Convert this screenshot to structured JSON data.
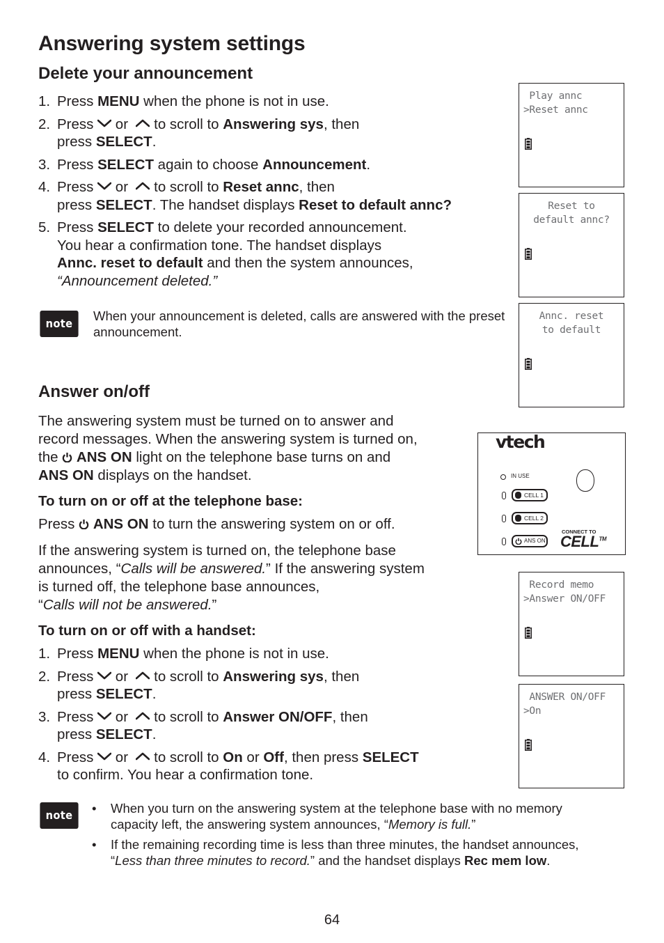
{
  "page": {
    "title": "Answering system settings",
    "page_number": "64"
  },
  "delete_section": {
    "heading": "Delete your announcement",
    "steps": [
      {
        "num": "1.",
        "parts": [
          "Press ",
          "MENU",
          " when the phone is not in use."
        ]
      },
      {
        "num": "2.",
        "parts": [
          "Press ",
          " or ",
          " to scroll to ",
          "Answering sys",
          ", then",
          "press ",
          "SELECT",
          "."
        ]
      },
      {
        "num": "3.",
        "parts": [
          "Press ",
          "SELECT",
          " again to choose ",
          "Announcement",
          "."
        ]
      },
      {
        "num": "4.",
        "parts": [
          "Press ",
          " or ",
          " to scroll to ",
          "Reset annc",
          ", then",
          "press ",
          "SELECT",
          ". The handset displays ",
          "Reset to default annc?"
        ]
      },
      {
        "num": "5.",
        "parts": [
          "Press ",
          "SELECT",
          " to delete your recorded announcement.",
          "You hear a confirmation tone. The handset displays",
          "Annc. reset to default",
          " and then the system announces,",
          "“Announcement deleted.”"
        ]
      }
    ],
    "note": {
      "badge": "note",
      "text": "When your announcement is deleted, calls are answered with the preset announcement."
    }
  },
  "handset_screens": {
    "screen1": {
      "lines": [
        " Play annc",
        ">Reset annc"
      ],
      "battery_icon": "battery-full-icon"
    },
    "screen2": {
      "lines": [
        "Reset to",
        "default annc?"
      ],
      "battery_icon": "battery-full-icon"
    },
    "screen3": {
      "lines": [
        "Annc. reset",
        "to default"
      ],
      "battery_icon": "battery-full-icon"
    },
    "screen4": {
      "lines": [
        " Record memo",
        ">Answer ON/OFF"
      ],
      "battery_icon": "battery-full-icon"
    },
    "screen5": {
      "lines": [
        " ANSWER ON/OFF",
        ">On"
      ],
      "battery_icon": "battery-full-icon"
    }
  },
  "telephone_base": {
    "brand": "vtech",
    "in_use_label": "IN USE",
    "buttons": [
      "CELL 1",
      "CELL 2",
      "ANS ON"
    ],
    "connect_label": "CONNECT TO",
    "cell_logo": "CELL",
    "trademark": "TM"
  },
  "answer_section": {
    "heading": "Answer on/off",
    "intro": {
      "p1": "The answering system must be turned on to answer and",
      "p2": "record messages. When the answering system is turned on,",
      "p3a": "the ",
      "p3b": "ANS ON",
      "p3c": " light on the telephone base turns on and",
      "p4a": "ANS ON",
      "p4b": " displays on the handset."
    },
    "base_subheading": "To turn on or off at the telephone base:",
    "base_instruction": {
      "a": "Press ",
      "b": "ANS ON",
      "c": " to turn the answering system on or off."
    },
    "base_para": {
      "l1": "If the answering system is turned on, the telephone base",
      "l2a": "announces, “",
      "l2b": "Calls will be answered.",
      "l2c": "” If the answering system",
      "l3": "is turned off, the telephone base announces,",
      "l4a": "“",
      "l4b": "Calls will not be answered.",
      "l4c": "”"
    },
    "handset_subheading": "To turn on or off with a handset:",
    "steps": [
      {
        "num": "1.",
        "parts": [
          "Press ",
          "MENU",
          " when the phone is not in use."
        ]
      },
      {
        "num": "2.",
        "parts": [
          "Press ",
          " or ",
          " to scroll to ",
          "Answering sys",
          ", then",
          "press ",
          "SELECT",
          "."
        ]
      },
      {
        "num": "3.",
        "parts": [
          "Press ",
          " or ",
          " to scroll to ",
          "Answer ON/OFF",
          ", then",
          "press ",
          "SELECT",
          "."
        ]
      },
      {
        "num": "4.",
        "parts": [
          "Press ",
          " or ",
          " to scroll to ",
          "On",
          " or ",
          "Off",
          ", then press ",
          "SELECT",
          "to confirm. You hear a confirmation tone."
        ]
      }
    ],
    "note": {
      "badge": "note",
      "bullet": "•",
      "items": [
        {
          "a": "When you turn on the answering system at the telephone base with no memory",
          "b": "capacity left, the answering system announces, “",
          "c": "Memory is full.",
          "d": "”"
        },
        {
          "a": "If the remaining recording time is less than three minutes, the handset announces,",
          "b": "“",
          "c": "Less than three minutes to record.",
          "d": "” and the handset displays ",
          "e": "Rec mem low",
          "f": "."
        }
      ]
    }
  }
}
